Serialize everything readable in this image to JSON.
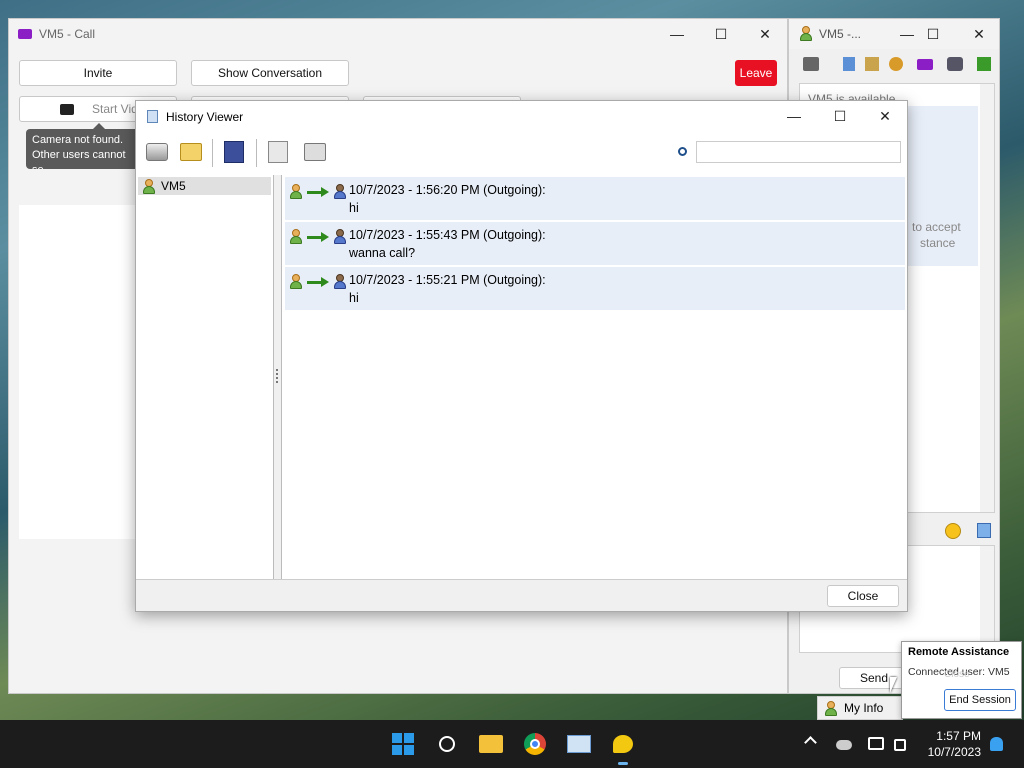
{
  "call_window": {
    "title": "VM5 - Call",
    "invite_label": "Invite",
    "show_conversation_label": "Show Conversation",
    "leave_label": "Leave",
    "start_video_label": "Start Video",
    "tooltip_line1": "Camera not found.",
    "tooltip_line2": "Other users cannot se"
  },
  "chat_window": {
    "title": "VM5 -...",
    "status_text": "VM5 is available",
    "partial_line1": "to accept",
    "partial_line2": "stance",
    "send_label": "Send",
    "my_info_label": "My Info"
  },
  "history_viewer": {
    "title": "History Viewer",
    "search_value": "",
    "contacts": [
      {
        "name": "VM5"
      }
    ],
    "messages": [
      {
        "header": "10/7/2023 - 1:56:20 PM (Outgoing):",
        "text": "hi"
      },
      {
        "header": "10/7/2023 - 1:55:43 PM (Outgoing):",
        "text": "wanna call?"
      },
      {
        "header": "10/7/2023 - 1:55:21 PM (Outgoing):",
        "text": "hi"
      }
    ],
    "close_label": "Close"
  },
  "remote_assistance": {
    "title": "Remote Assistance",
    "connected_label": "Connected user:",
    "connected_user": "VM5",
    "end_session_label": "End Session",
    "ghost_label": "Close"
  },
  "taskbar": {
    "time": "1:57 PM",
    "date": "10/7/2023"
  },
  "colors": {
    "leave_red": "#e81123",
    "message_bg": "#e8eef8",
    "video_purple": "#8b1ec4"
  }
}
